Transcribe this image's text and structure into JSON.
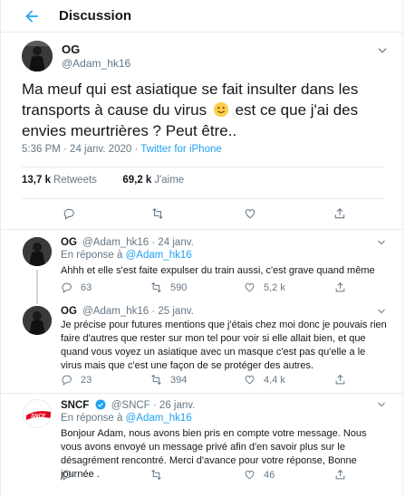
{
  "header": {
    "title": "Discussion"
  },
  "main_tweet": {
    "author_name": "OG",
    "author_handle": "@Adam_hk16",
    "text_before_emoji": "Ma meuf qui est asiatique se fait insulter dans les transports à cause du virus",
    "text_after_emoji": "est ce que j'ai des envies meurtrières ? Peut être..",
    "emoji": "slightly-smiling-face",
    "timestamp": "5:36 PM · 24 janv. 2020",
    "source": "Twitter for iPhone",
    "retweets_count": "13,7 k",
    "retweets_label": "Retweets",
    "likes_count": "69,2 k",
    "likes_label": "J'aime"
  },
  "replies": [
    {
      "name": "OG",
      "handle": "@Adam_hk16",
      "date": "· 24 janv.",
      "reply_prefix": "En réponse à",
      "reply_to": "@Adam_hk16",
      "text": "Ahhh et elle s'est faite expulser du train aussi, c'est grave quand même",
      "replies_count": "63",
      "retweets_count": "590",
      "likes_count": "5,2 k"
    },
    {
      "name": "OG",
      "handle": "@Adam_hk16",
      "date": "· 25 janv.",
      "text": "Je précise pour futures mentions que j'étais chez moi donc je pouvais rien faire d'autres que rester sur mon tel pour voir si elle allait bien, et que quand vous voyez un asiatique avec un masque c'est pas qu'elle a le virus mais que c'est une façon de se protéger des autres.",
      "replies_count": "23",
      "retweets_count": "394",
      "likes_count": "4,4 k"
    },
    {
      "name": "SNCF",
      "handle": "@SNCF",
      "date": "· 26 janv.",
      "reply_prefix": "En réponse à",
      "reply_to": "@Adam_hk16",
      "text": "Bonjour Adam, nous avons bien pris en compte votre message. Nous vous avons envoyé un message privé afin d'en savoir plus sur le désagrément rencontré. Merci d'avance pour votre réponse,  Bonne journée .",
      "replies_count": "",
      "retweets_count": "",
      "likes_count": "46",
      "logo_text": "SNCF"
    }
  ],
  "colors": {
    "accent": "#1da1f2",
    "muted": "#657786",
    "text": "#14171a",
    "border": "#e6ecf0",
    "sncf_red": "#e2001a"
  },
  "icons": [
    "back-arrow-icon",
    "chevron-down-icon",
    "reply-icon",
    "retweet-icon",
    "like-icon",
    "share-icon",
    "verified-icon"
  ]
}
